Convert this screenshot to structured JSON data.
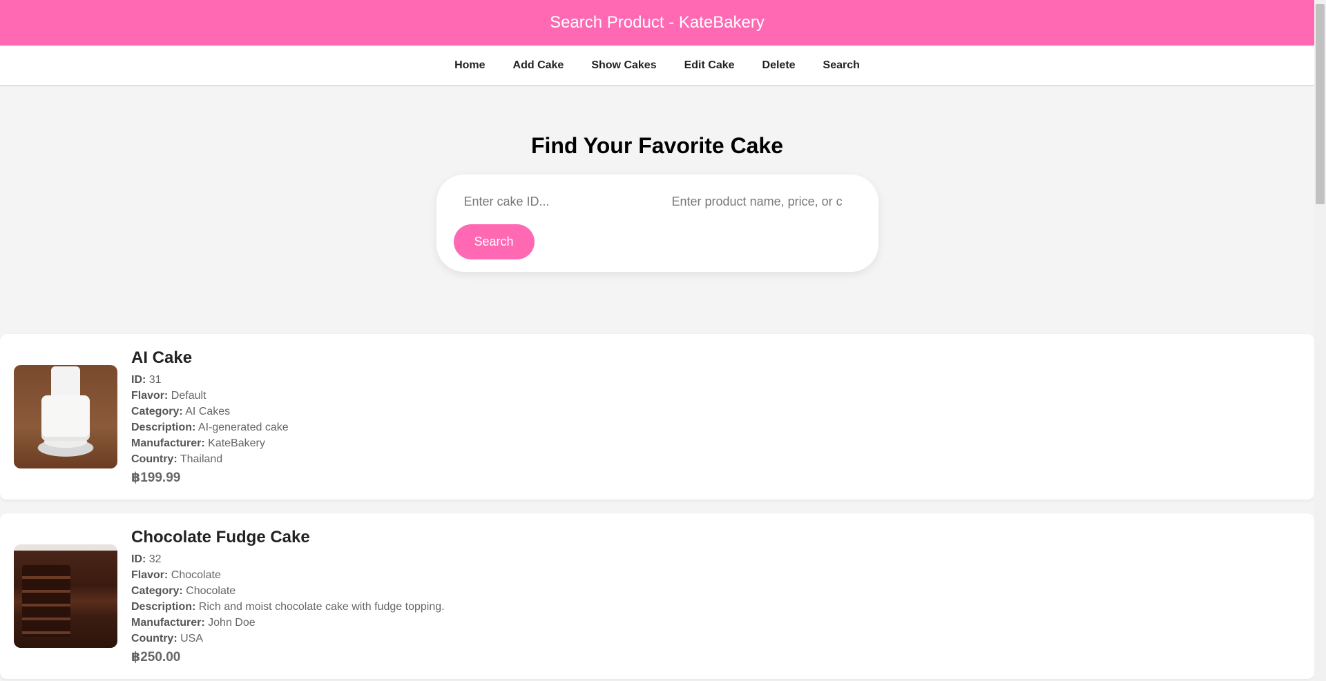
{
  "header": {
    "title": "Search Product - KateBakery"
  },
  "nav": {
    "items": [
      {
        "label": "Home"
      },
      {
        "label": "Add Cake"
      },
      {
        "label": "Show Cakes"
      },
      {
        "label": "Edit Cake"
      },
      {
        "label": "Delete"
      },
      {
        "label": "Search"
      }
    ]
  },
  "hero": {
    "title": "Find Your Favorite Cake"
  },
  "search": {
    "id_placeholder": "Enter cake ID...",
    "query_placeholder": "Enter product name, price, or category...",
    "button_label": "Search"
  },
  "labels": {
    "id": "ID:",
    "flavor": "Flavor:",
    "category": "Category:",
    "description": "Description:",
    "manufacturer": "Manufacturer:",
    "country": "Country:"
  },
  "results": [
    {
      "name": "AI Cake",
      "id": "31",
      "flavor": "Default",
      "category": "AI Cakes",
      "description": "AI-generated cake",
      "manufacturer": "KateBakery",
      "country": "Thailand",
      "price": "฿199.99"
    },
    {
      "name": "Chocolate Fudge Cake",
      "id": "32",
      "flavor": "Chocolate",
      "category": "Chocolate",
      "description": "Rich and moist chocolate cake with fudge topping.",
      "manufacturer": "John Doe",
      "country": "USA",
      "price": "฿250.00"
    }
  ],
  "colors": {
    "brand_pink": "#ff69b4",
    "page_bg": "#f4f4f4"
  }
}
